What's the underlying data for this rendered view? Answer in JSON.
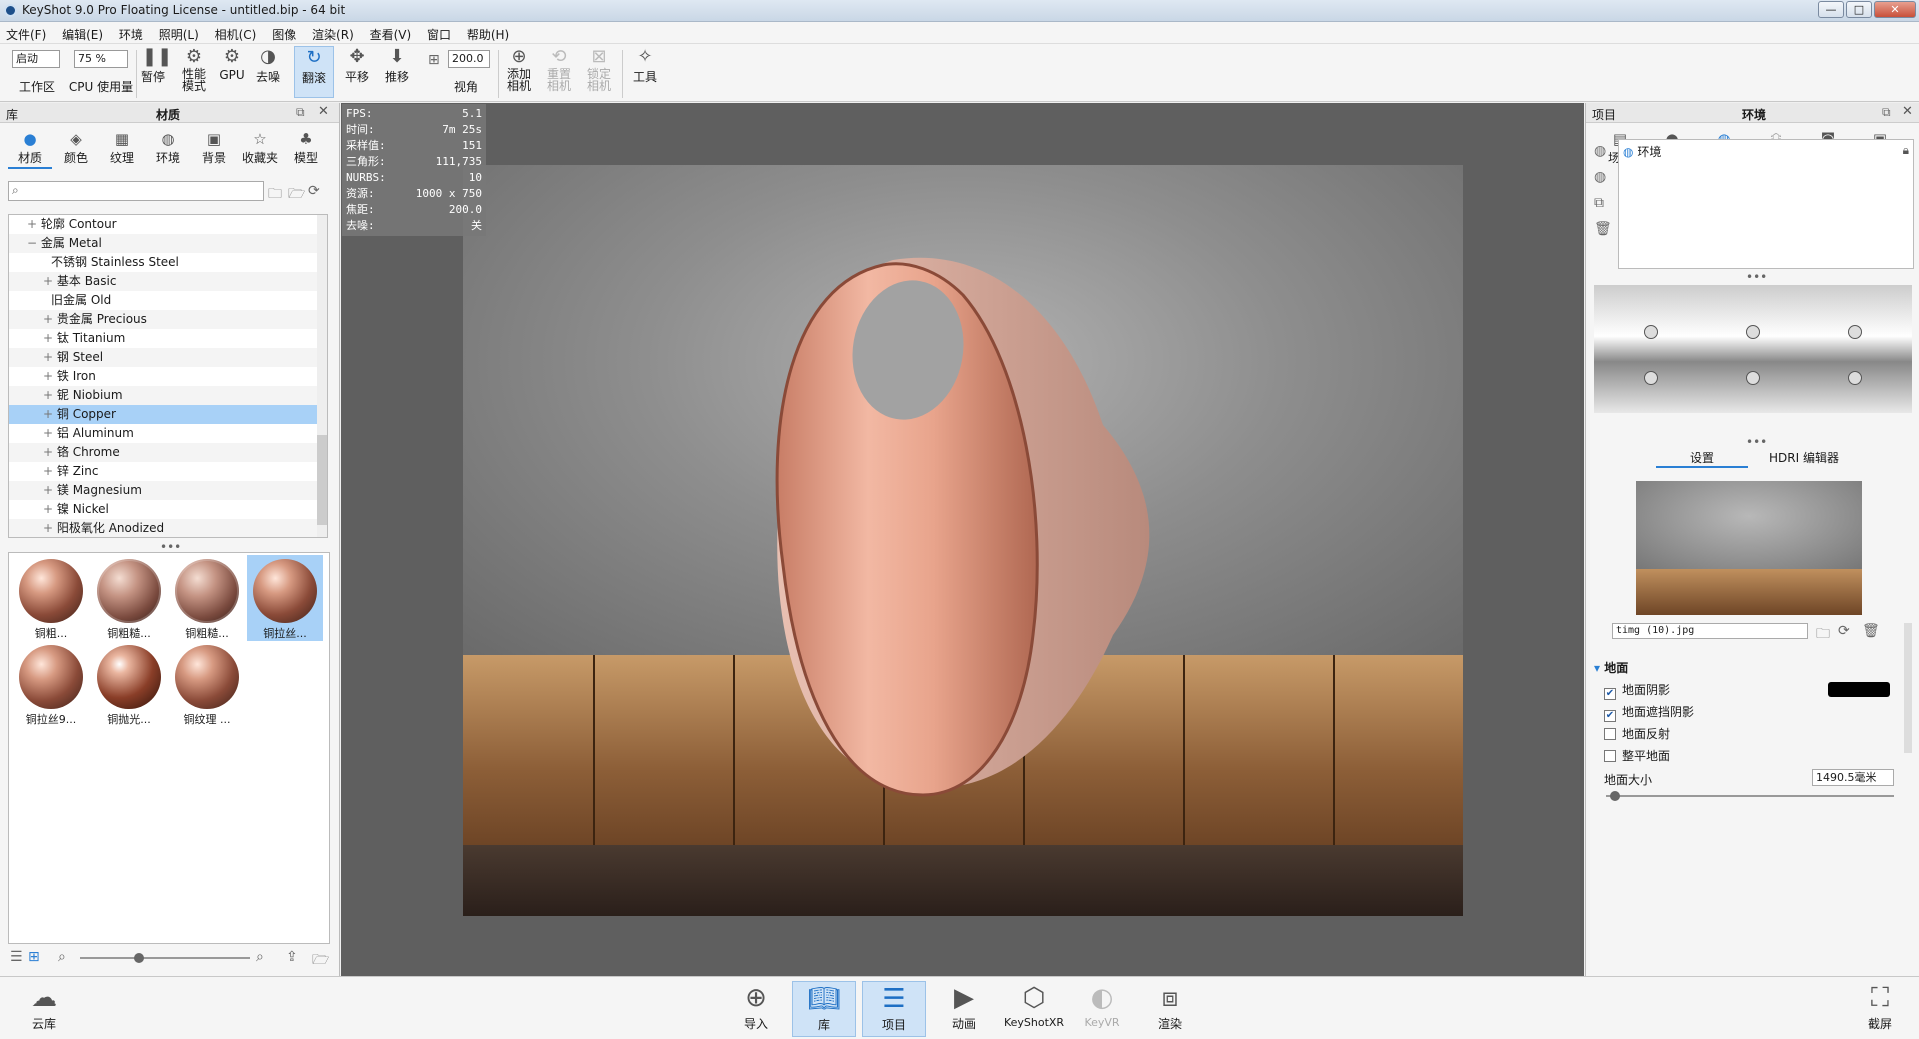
{
  "window": {
    "title": "KeyShot 9.0 Pro Floating License  - untitled.bip  - 64 bit",
    "minimize": "—",
    "maximize": "□",
    "close": "✕"
  },
  "menu": [
    "文件(F)",
    "编辑(E)",
    "环境",
    "照明(L)",
    "相机(C)",
    "图像",
    "渲染(R)",
    "查看(V)",
    "窗口",
    "帮助(H)"
  ],
  "toolbar": {
    "workspace_value": "启动",
    "workspace_label": "工作区",
    "cpu_value": "75 %",
    "cpu_label": "CPU 使用量",
    "pause": "暂停",
    "perf1": "性能",
    "perf2": "模式",
    "gpu": "GPU",
    "denoise": "去噪",
    "tumble": "翻滚",
    "pan": "平移",
    "dolly": "推移",
    "fov_value": "200.0",
    "fov_label": "视角",
    "addcam1": "添加",
    "addcam2": "相机",
    "resetcam1": "重置",
    "resetcam2": "相机",
    "lockcam1": "锁定",
    "lockcam2": "相机",
    "tools": "工具"
  },
  "library": {
    "panel_label": "库",
    "panel_title": "材质",
    "tabs": [
      "材质",
      "颜色",
      "纹理",
      "环境",
      "背景",
      "收藏夹",
      "模型"
    ],
    "search_placeholder": "",
    "tree": [
      "轮廓 Contour",
      "金属 Metal",
      "不锈钢 Stainless Steel",
      "基本 Basic",
      "旧金属 Old",
      "贵金属 Precious",
      "钛 Titanium",
      "钢 Steel",
      "铁 Iron",
      "铌 Niobium",
      "铜 Copper",
      "铝 Aluminum",
      "铬 Chrome",
      "锌 Zinc",
      "镁 Magnesium",
      "镍 Nickel",
      "阳极氧化 Anodized"
    ],
    "thumbs": [
      "铜粗...",
      "铜粗糙...",
      "铜粗糙...",
      "铜拉丝...",
      "铜拉丝9...",
      "铜抛光...",
      "铜纹理 ..."
    ]
  },
  "stats": [
    {
      "k": "FPS:",
      "v": "5.1"
    },
    {
      "k": "时间:",
      "v": "7m 25s"
    },
    {
      "k": "采样值:",
      "v": "151"
    },
    {
      "k": "三角形:",
      "v": "111,735"
    },
    {
      "k": "NURBS:",
      "v": "10"
    },
    {
      "k": "资源:",
      "v": "1000 x 750"
    },
    {
      "k": "焦距:",
      "v": "200.0"
    },
    {
      "k": "去噪:",
      "v": "关"
    }
  ],
  "project": {
    "panel_label": "项目",
    "panel_title": "环境",
    "tabs": [
      "场景",
      "材质",
      "环境",
      "照明",
      "相机",
      "图像"
    ],
    "env_item": "环境",
    "subtabs": [
      "设置",
      "HDRI 编辑器"
    ],
    "hdri_file": "timg (10).jpg",
    "ground_section": "地面",
    "ground_shadow": "地面阴影",
    "ground_occlusion": "地面遮挡阴影",
    "ground_reflection": "地面反射",
    "flatten_ground": "整平地面",
    "ground_size_label": "地面大小",
    "ground_size_value": "1490.5毫米",
    "checks": {
      "shadow": true,
      "occlusion": true,
      "reflection": false,
      "flatten": false
    }
  },
  "bottom": {
    "cloud": "云库",
    "import": "导入",
    "library": "库",
    "project": "项目",
    "animation": "动画",
    "keyshotxr": "KeyShotXR",
    "keyvr": "KeyVR",
    "render": "渲染",
    "screenshot": "截屏"
  },
  "colors": {
    "accent": "#2a7fd4",
    "selection": "#a8d1f7",
    "viewport": "#5f5f5f",
    "copper": "#d79a82"
  }
}
